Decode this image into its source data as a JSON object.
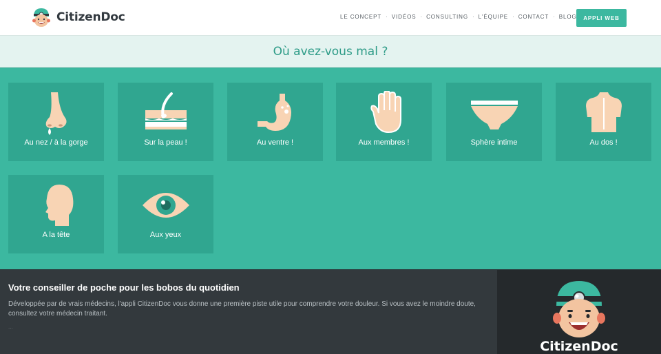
{
  "brand": {
    "name": "CitizenDoc",
    "logo_icon": "doctor-face-icon"
  },
  "nav": {
    "items": [
      "LE CONCEPT",
      "VIDÉOS",
      "CONSULTING",
      "L'ÉQUIPE",
      "CONTACT",
      "BLOG"
    ],
    "separator": "·",
    "app_button": "APPLI WEB"
  },
  "question": "Où avez-vous mal ?",
  "tiles": [
    {
      "label": "Au nez / à la gorge",
      "icon": "nose-icon"
    },
    {
      "label": "Sur la peau !",
      "icon": "skin-hair-icon"
    },
    {
      "label": "Au ventre !",
      "icon": "stomach-icon"
    },
    {
      "label": "Aux membres !",
      "icon": "hand-icon"
    },
    {
      "label": "Sphère intime",
      "icon": "underwear-icon"
    },
    {
      "label": "Au dos !",
      "icon": "back-icon"
    },
    {
      "label": "A la tête",
      "icon": "head-icon"
    },
    {
      "label": "Aux yeux",
      "icon": "eye-icon"
    }
  ],
  "footer": {
    "title": "Votre conseiller de poche pour les bobos du quotidien",
    "text": "Développée par de vrais médecins, l'appli CitizenDoc vous donne une première piste utile pour comprendre votre douleur. Si vous avez le moindre doute, consultez votre médecin traitant.",
    "dots": "...",
    "brand_name": "CitizenDoc"
  },
  "colors": {
    "accent": "#3cb8a0",
    "tile": "#30a690",
    "skin": "#f8d4b4",
    "footer_bg": "#33393d"
  }
}
